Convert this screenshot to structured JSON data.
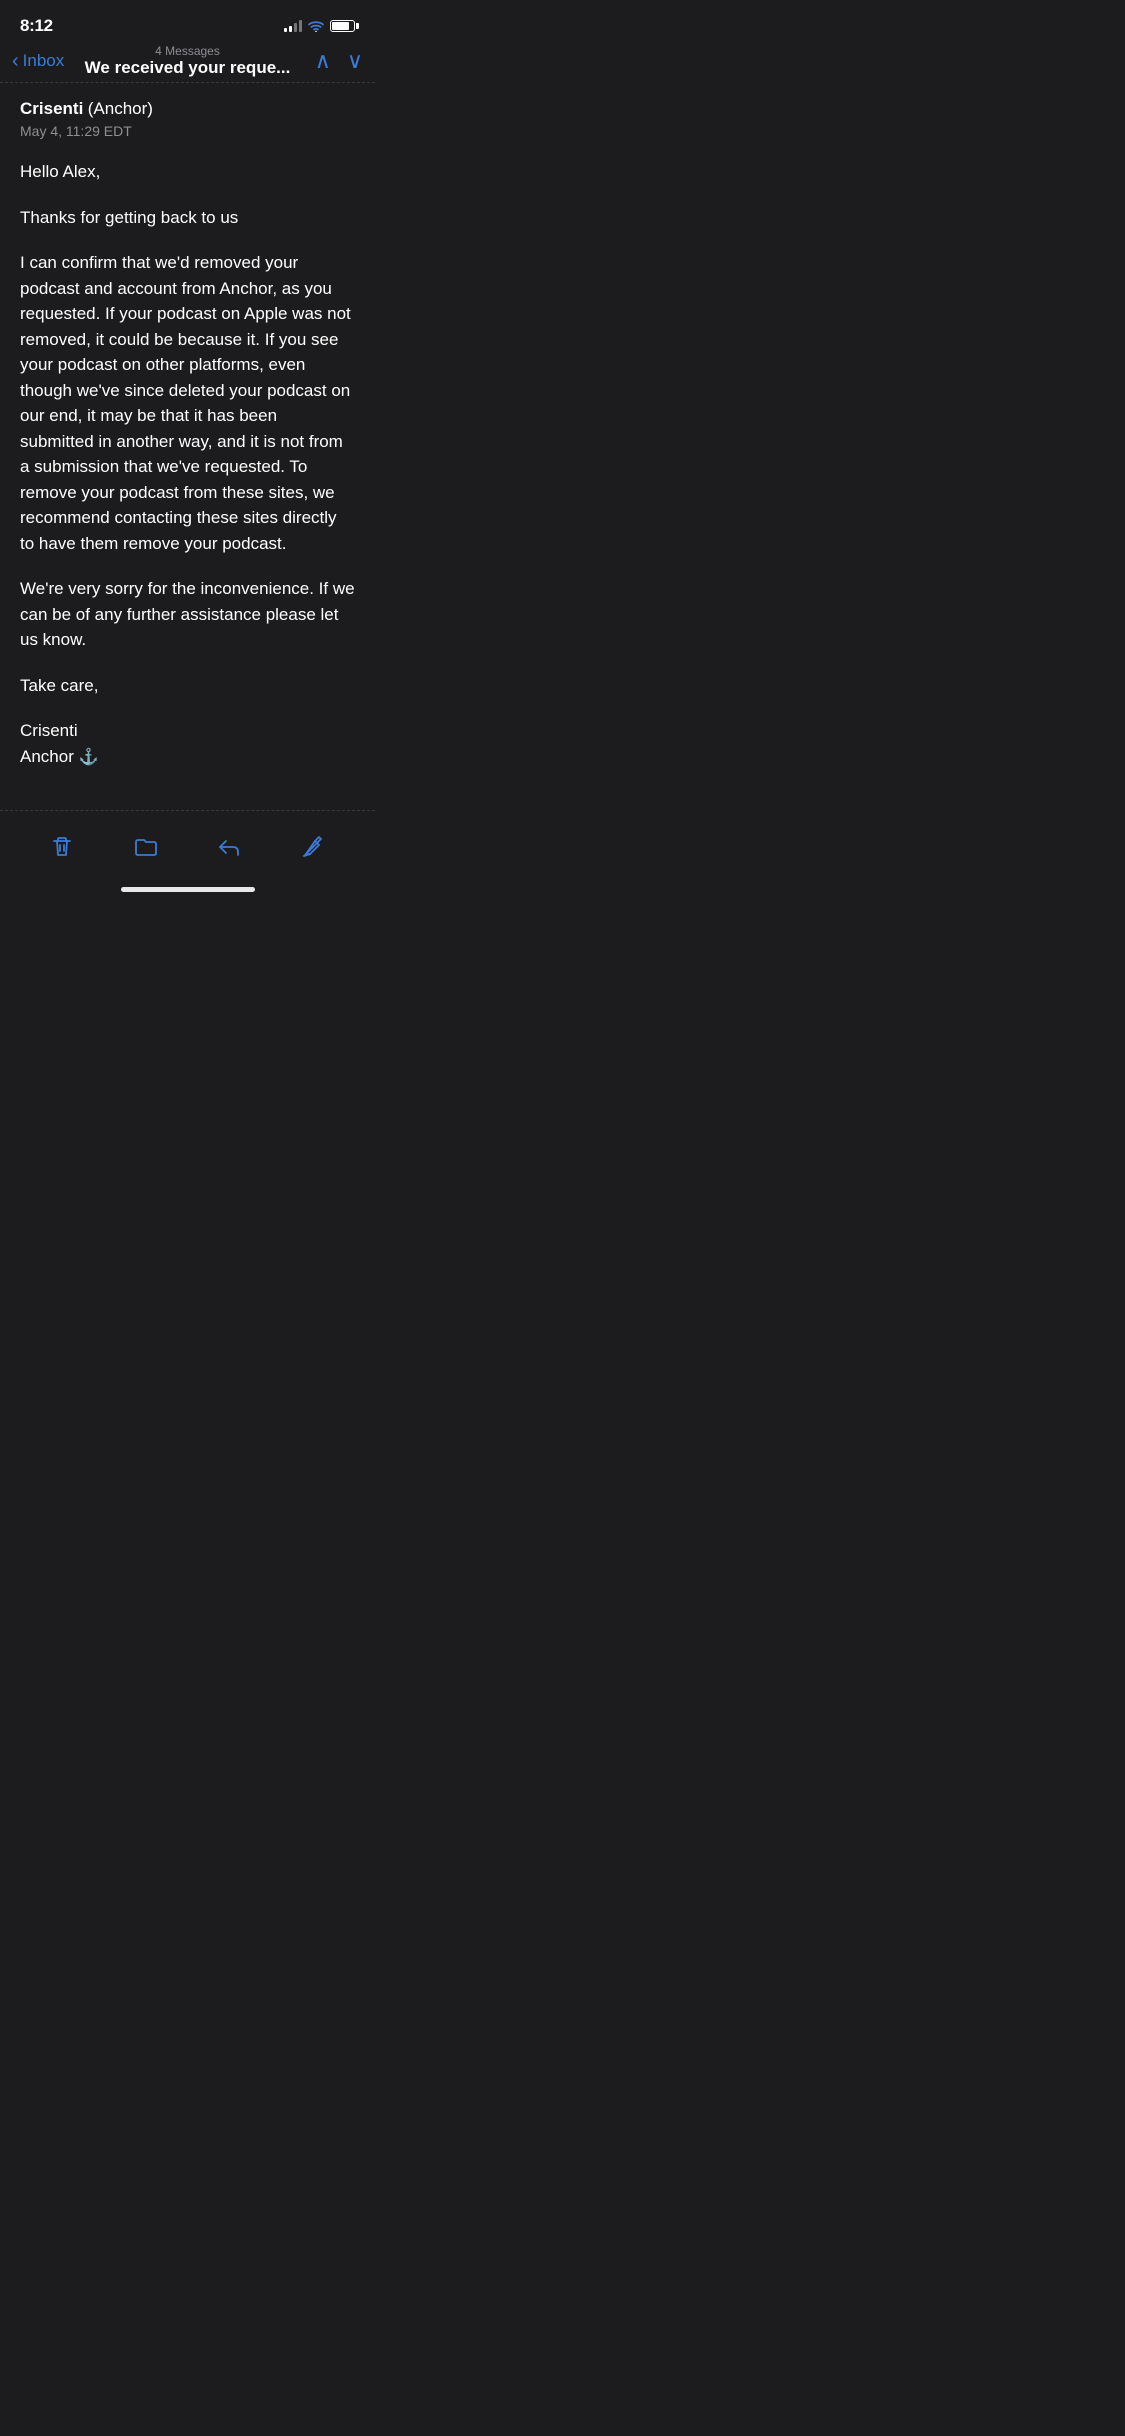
{
  "status_bar": {
    "time": "8:12",
    "signal_strength": 2,
    "wifi": true,
    "battery_percent": 80
  },
  "nav": {
    "back_label": "Inbox",
    "message_count": "4 Messages",
    "subject": "We received your reque...",
    "prev_arrow": "∧",
    "next_arrow": "∨"
  },
  "email": {
    "sender_name": "Crisenti",
    "sender_org": "(Anchor)",
    "date": "May 4, 11:29 EDT",
    "greeting": "Hello Alex,",
    "body_paragraph_1": "Thanks for getting back to us",
    "body_paragraph_2": "I can confirm that we'd removed your podcast and account from Anchor, as you requested. If your podcast on Apple was not removed, it could be because it. If you see your podcast on other platforms, even though we've since deleted your podcast on our end, it may be that it has been submitted in another way, and it is not from a submission that we've requested. To remove your podcast from these sites, we recommend contacting these sites directly to have them remove your podcast.",
    "body_paragraph_3": "We're very sorry for the inconvenience. If we can be of any further assistance please let us know.",
    "closing": "Take care,",
    "signature_name": "Crisenti",
    "signature_org": "Anchor",
    "anchor_icon": "⚓"
  },
  "toolbar": {
    "delete_label": "delete",
    "folder_label": "folder",
    "reply_label": "reply",
    "compose_label": "compose"
  }
}
